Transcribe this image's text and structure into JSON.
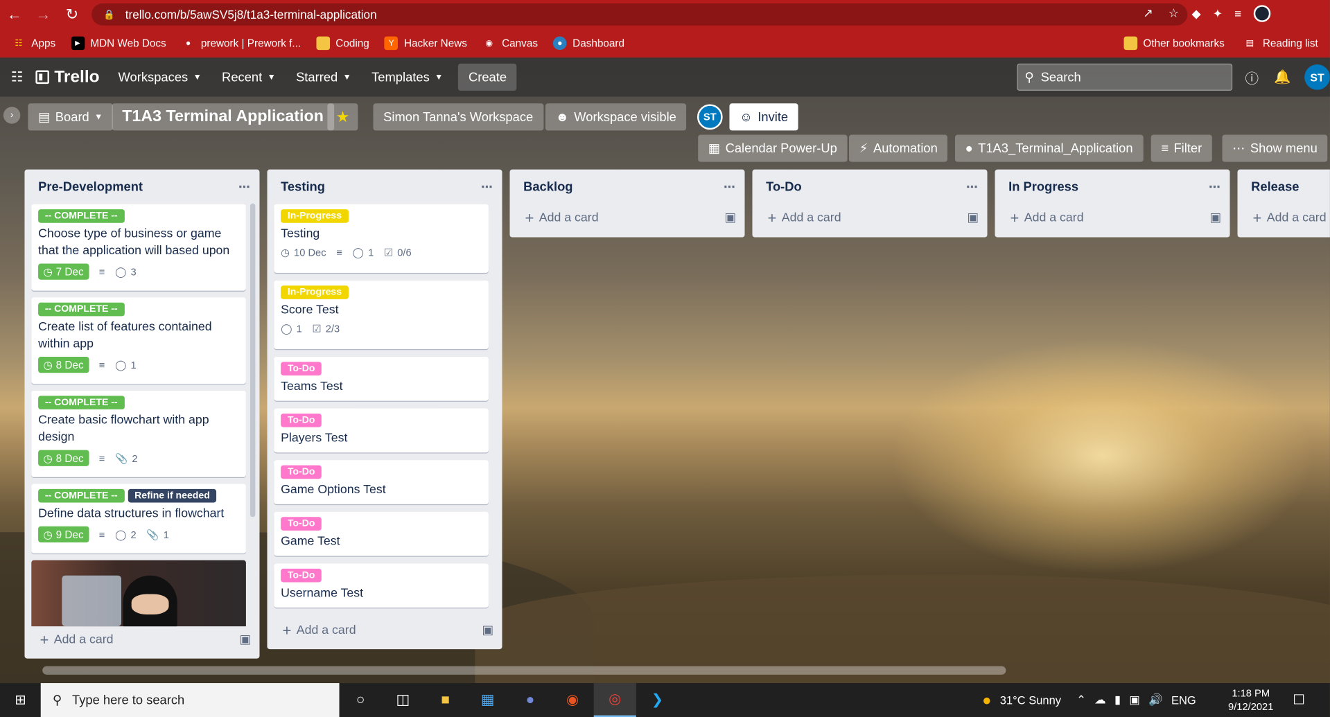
{
  "browser": {
    "url": "trello.com/b/5awSV5j8/t1a3-terminal-application",
    "bookmarks": [
      {
        "label": "Apps",
        "icon": "apps-grid-icon"
      },
      {
        "label": "MDN Web Docs",
        "icon": "mdn-icon"
      },
      {
        "label": "prework | Prework f...",
        "icon": "github-icon"
      },
      {
        "label": "Coding",
        "icon": "folder-icon"
      },
      {
        "label": "Hacker News",
        "icon": "hacker-news-icon"
      },
      {
        "label": "Canvas",
        "icon": "canvas-icon"
      },
      {
        "label": "Dashboard",
        "icon": "dashboard-icon"
      }
    ],
    "bookmarks_right": [
      "Other bookmarks",
      "Reading list"
    ]
  },
  "trello_header": {
    "logo": "Trello",
    "menus": [
      "Workspaces",
      "Recent",
      "Starred",
      "Templates"
    ],
    "create": "Create",
    "search_placeholder": "Search",
    "avatar": "ST"
  },
  "board": {
    "view": "Board",
    "title": "T1A3 Terminal Application",
    "workspace": "Simon Tanna's Workspace",
    "visibility": "Workspace visible",
    "member_avatar": "ST",
    "invite": "Invite",
    "powerups": [
      "Calendar Power-Up",
      "Automation",
      "T1A3_Terminal_Application"
    ],
    "filter": "Filter",
    "show_menu": "Show menu"
  },
  "lists": [
    {
      "title": "Pre-Development",
      "cards": [
        {
          "labels": [
            {
              "text": "-- COMPLETE --",
              "color": "#61bd4f"
            }
          ],
          "title": "Choose type of business or game that the application will based upon",
          "due": "7 Dec",
          "comments": "3"
        },
        {
          "labels": [
            {
              "text": "-- COMPLETE --",
              "color": "#61bd4f"
            }
          ],
          "title": "Create list of features contained within app",
          "due": "8 Dec",
          "comments": "1"
        },
        {
          "labels": [
            {
              "text": "-- COMPLETE --",
              "color": "#61bd4f"
            }
          ],
          "title": "Create basic flowchart with app design",
          "due": "8 Dec",
          "attachments": "2"
        },
        {
          "labels": [
            {
              "text": "-- COMPLETE --",
              "color": "#61bd4f"
            },
            {
              "text": "Refine if needed",
              "color": "#344563"
            }
          ],
          "title": "Define data structures in flowchart",
          "due": "9 Dec",
          "comments": "2",
          "attachments": "1"
        }
      ],
      "add_card": "Add a card"
    },
    {
      "title": "Testing",
      "cards": [
        {
          "labels": [
            {
              "text": "In-Progress",
              "color": "#f2d600"
            }
          ],
          "title": "Testing",
          "date": "10 Dec",
          "comments": "1",
          "checklist": "0/6"
        },
        {
          "labels": [
            {
              "text": "In-Progress",
              "color": "#f2d600"
            }
          ],
          "title": "Score Test",
          "comments": "1",
          "checklist": "2/3"
        },
        {
          "labels": [
            {
              "text": "To-Do",
              "color": "#ff78cb"
            }
          ],
          "title": "Teams Test"
        },
        {
          "labels": [
            {
              "text": "To-Do",
              "color": "#ff78cb"
            }
          ],
          "title": "Players Test"
        },
        {
          "labels": [
            {
              "text": "To-Do",
              "color": "#ff78cb"
            }
          ],
          "title": "Game Options Test"
        },
        {
          "labels": [
            {
              "text": "To-Do",
              "color": "#ff78cb"
            }
          ],
          "title": "Game Test"
        },
        {
          "labels": [
            {
              "text": "To-Do",
              "color": "#ff78cb"
            }
          ],
          "title": "Username Test"
        }
      ],
      "add_card": "Add a card"
    },
    {
      "title": "Backlog",
      "add_card": "Add a card"
    },
    {
      "title": "To-Do",
      "add_card": "Add a card"
    },
    {
      "title": "In Progress",
      "add_card": "Add a card"
    },
    {
      "title": "Release",
      "add_card": "Add a card"
    }
  ],
  "taskbar": {
    "search_placeholder": "Type here to search",
    "weather": "31°C  Sunny",
    "language": "ENG",
    "time": "1:18 PM",
    "date": "9/12/2021"
  }
}
